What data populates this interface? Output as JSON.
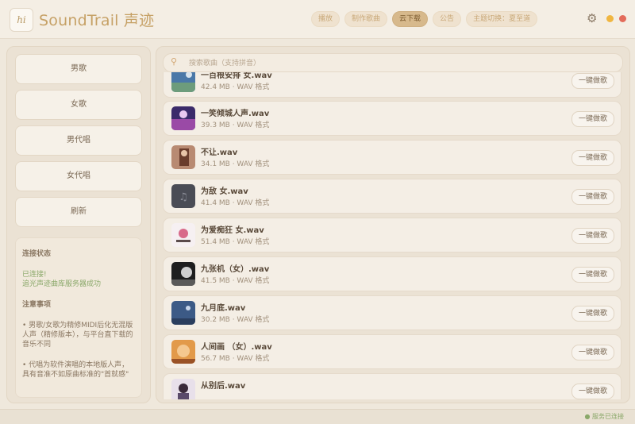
{
  "header": {
    "logo_text": "hi",
    "title": "SoundTrail 声迹",
    "tabs": [
      {
        "label": "播放"
      },
      {
        "label": "制作歌曲"
      },
      {
        "label": "云下载"
      },
      {
        "label": "公告"
      },
      {
        "label": "主题切换：夏至道"
      }
    ],
    "active_tab": 2
  },
  "sidebar": {
    "buttons": [
      {
        "label": "男歌"
      },
      {
        "label": "女歌"
      },
      {
        "label": "男代唱"
      },
      {
        "label": "女代唱"
      },
      {
        "label": "刷新"
      }
    ],
    "status": {
      "heading": "连接状态",
      "line1": "已连接!",
      "line2": "追光声迹曲库服务器成功",
      "notes_heading": "注意事项",
      "note1": "• 男歌/女歌为精修MIDI后化无混版人声（精修版本），与平台直下载的音乐不同",
      "note2": "• 代唱为软件演唱的本地版人声，具有音准不如原曲标准的\"首就感\""
    }
  },
  "main": {
    "search": {
      "placeholder": "搜索歌曲（支持拼音）"
    },
    "fetch_label": "一键做歌",
    "items": [
      {
        "name": "一百根安排 女.wav",
        "size": "42.4 MB · WAV 格式"
      },
      {
        "name": "一笑倾城人声.wav",
        "size": "39.3 MB · WAV 格式"
      },
      {
        "name": "不让.wav",
        "size": "34.1 MB · WAV 格式"
      },
      {
        "name": "为敌 女.wav",
        "size": "41.4 MB · WAV 格式"
      },
      {
        "name": "为爱痴狂 女.wav",
        "size": "51.4 MB · WAV 格式"
      },
      {
        "name": "九张机（女）.wav",
        "size": "41.5 MB · WAV 格式"
      },
      {
        "name": "九月底.wav",
        "size": "30.2 MB · WAV 格式"
      },
      {
        "name": "人间画 （女）.wav",
        "size": "56.7 MB · WAV 格式"
      },
      {
        "name": "从别后.wav",
        "size": ""
      }
    ]
  },
  "footer": {
    "status": "● 服务已连接"
  },
  "colors": {
    "accent": "#c6a166",
    "active_tab": "#d7b98c",
    "connected": "#8aa86a"
  }
}
